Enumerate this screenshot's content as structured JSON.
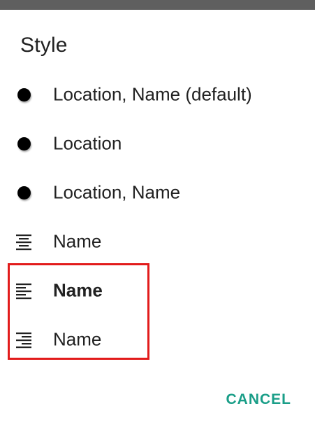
{
  "dialog": {
    "title": "Style",
    "options": [
      {
        "label": "Location, Name (default)",
        "icon": "bullet-dot-icon",
        "bold": false
      },
      {
        "label": "Location",
        "icon": "bullet-dot-icon",
        "bold": false
      },
      {
        "label": "Location, Name",
        "icon": "bullet-dot-icon",
        "bold": false
      },
      {
        "label": "Name",
        "icon": "align-center-icon",
        "bold": false
      },
      {
        "label": "Name",
        "icon": "align-left-icon",
        "bold": true
      },
      {
        "label": "Name",
        "icon": "align-right-icon",
        "bold": false
      }
    ],
    "cancel_label": "CANCEL"
  },
  "colors": {
    "accent": "#1a9e88",
    "highlight": "#e21b1b",
    "status_bar": "#5f5f5f"
  }
}
